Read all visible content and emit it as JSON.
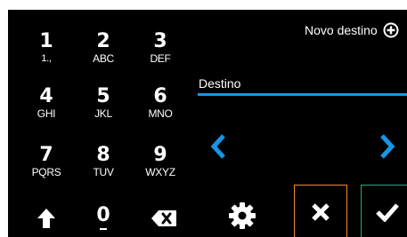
{
  "header": {
    "new_destination_label": "Novo destino",
    "new_destination_icon": "plus-circle-icon"
  },
  "destination": {
    "label": "Destino",
    "value": ""
  },
  "keypad": {
    "keys": [
      {
        "digit": "1",
        "letters": "1.,"
      },
      {
        "digit": "2",
        "letters": "ABC"
      },
      {
        "digit": "3",
        "letters": "DEF"
      },
      {
        "digit": "4",
        "letters": "GHI"
      },
      {
        "digit": "5",
        "letters": "JKL"
      },
      {
        "digit": "6",
        "letters": "MNO"
      },
      {
        "digit": "7",
        "letters": "PQRS"
      },
      {
        "digit": "8",
        "letters": "TUV"
      },
      {
        "digit": "9",
        "letters": "WXYZ"
      },
      {
        "digit": "0",
        "letters": "_"
      }
    ],
    "shift_icon": "shift-up-arrow-icon",
    "backspace_icon": "backspace-icon"
  },
  "navigation": {
    "prev_icon": "chevron-left-icon",
    "next_icon": "chevron-right-icon"
  },
  "actions": {
    "settings_icon": "gear-icon",
    "cancel_icon": "close-icon",
    "confirm_icon": "checkmark-icon"
  },
  "colors": {
    "background": "#000000",
    "text": "#ffffff",
    "accent_blue": "#1796e6",
    "cancel_border": "#f08a24",
    "confirm_border": "#17b08a"
  }
}
